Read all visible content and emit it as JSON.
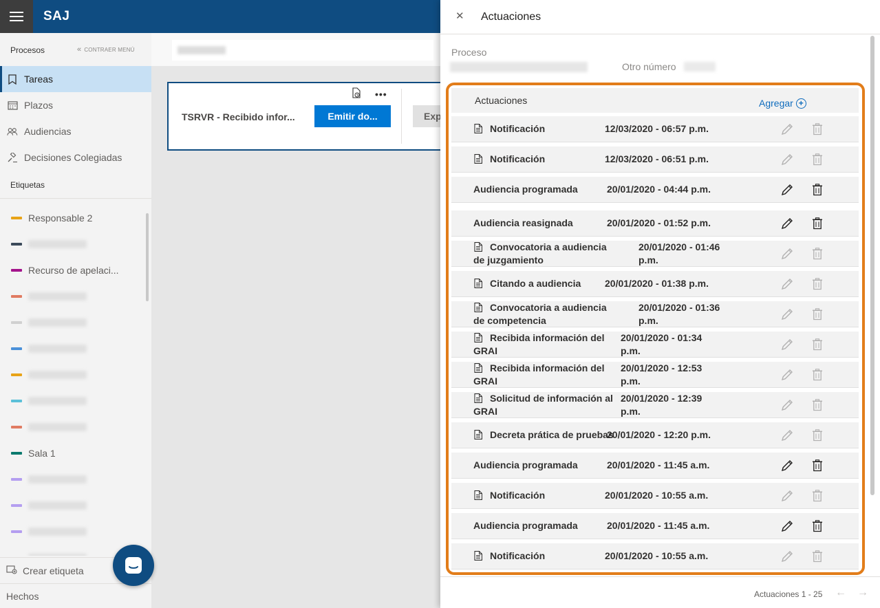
{
  "app": {
    "brand": "SAJ"
  },
  "sidebar": {
    "section": "Procesos",
    "collapse_label": "CONTRAER MENÚ",
    "nav": [
      {
        "label": "Tareas",
        "icon": "bookmark-icon",
        "active": true
      },
      {
        "label": "Plazos",
        "icon": "calendar-icon",
        "active": false
      },
      {
        "label": "Audiencias",
        "icon": "people-icon",
        "active": false
      },
      {
        "label": "Decisiones Colegiadas",
        "icon": "gavel-icon",
        "active": false
      }
    ],
    "tags_header": "Etiquetas",
    "tags": [
      {
        "label": "Responsable 2",
        "color": "#e8a317"
      },
      {
        "label": "",
        "color": "#3b4a5a"
      },
      {
        "label": "Recurso de apelaci...",
        "color": "#a4148c"
      },
      {
        "label": "",
        "color": "#e07b62"
      },
      {
        "label": "",
        "color": "#d0d0d0"
      },
      {
        "label": "",
        "color": "#4a90d9"
      },
      {
        "label": "",
        "color": "#e8a317"
      },
      {
        "label": "",
        "color": "#5bc0d8"
      },
      {
        "label": "",
        "color": "#e07b62"
      },
      {
        "label": "Sala 1",
        "color": "#0b7a6e"
      },
      {
        "label": "",
        "color": "#b49ef0"
      },
      {
        "label": "",
        "color": "#b49ef0"
      },
      {
        "label": "",
        "color": "#b49ef0"
      },
      {
        "label": "",
        "color": "#b49ef0"
      }
    ],
    "create_tag": "Crear etiqueta",
    "facts": "Hechos"
  },
  "main": {
    "card_title": "TSRVR - Recibido infor...",
    "primary_button": "Emitir do...",
    "secondary_button": "Exp"
  },
  "panel": {
    "title": "Actuaciones",
    "process_label": "Proceso",
    "other_number_label": "Otro número",
    "list_header": "Actuaciones",
    "add_label": "Agregar",
    "rows": [
      {
        "title": "Notificación",
        "date": "12/03/2020 - 06:57 p.m.",
        "doc": true,
        "enabled": false
      },
      {
        "title": "Notificación",
        "date": "12/03/2020 - 06:51 p.m.",
        "doc": true,
        "enabled": false
      },
      {
        "title": "Audiencia programada",
        "date": "20/01/2020 - 04:44 p.m.",
        "doc": false,
        "enabled": true
      },
      {
        "title": "Audiencia reasignada",
        "date": "20/01/2020 - 01:52 p.m.",
        "doc": false,
        "enabled": true
      },
      {
        "title": "Convocatoria a audiencia de juzgamiento",
        "date": "20/01/2020 - 01:46 p.m.",
        "doc": true,
        "enabled": false
      },
      {
        "title": "Citando a audiencia",
        "date": "20/01/2020 - 01:38 p.m.",
        "doc": true,
        "enabled": false
      },
      {
        "title": "Convocatoria a audiencia de competencia",
        "date": "20/01/2020 - 01:36 p.m.",
        "doc": true,
        "enabled": false
      },
      {
        "title": "Recibida información del GRAI",
        "date": "20/01/2020 - 01:34 p.m.",
        "doc": true,
        "enabled": false
      },
      {
        "title": "Recibida información del GRAI",
        "date": "20/01/2020 - 12:53 p.m.",
        "doc": true,
        "enabled": false
      },
      {
        "title": "Solicitud de información al GRAI",
        "date": "20/01/2020 - 12:39 p.m.",
        "doc": true,
        "enabled": false
      },
      {
        "title": "Decreta prática de pruebas",
        "date": "20/01/2020 - 12:20 p.m.",
        "doc": true,
        "enabled": false
      },
      {
        "title": "Audiencia programada",
        "date": "20/01/2020 - 11:45 a.m.",
        "doc": false,
        "enabled": true
      },
      {
        "title": "Notificación",
        "date": "20/01/2020 - 10:55 a.m.",
        "doc": true,
        "enabled": false
      },
      {
        "title": "Audiencia programada",
        "date": "20/01/2020 - 11:45 a.m.",
        "doc": false,
        "enabled": true
      },
      {
        "title": "Notificación",
        "date": "20/01/2020 - 10:55 a.m.",
        "doc": true,
        "enabled": false
      }
    ],
    "pagination": "Actuaciones 1 - 25"
  },
  "colors": {
    "brand": "#0f4c81",
    "accent": "#0078d4",
    "highlight": "#e27d1a"
  }
}
